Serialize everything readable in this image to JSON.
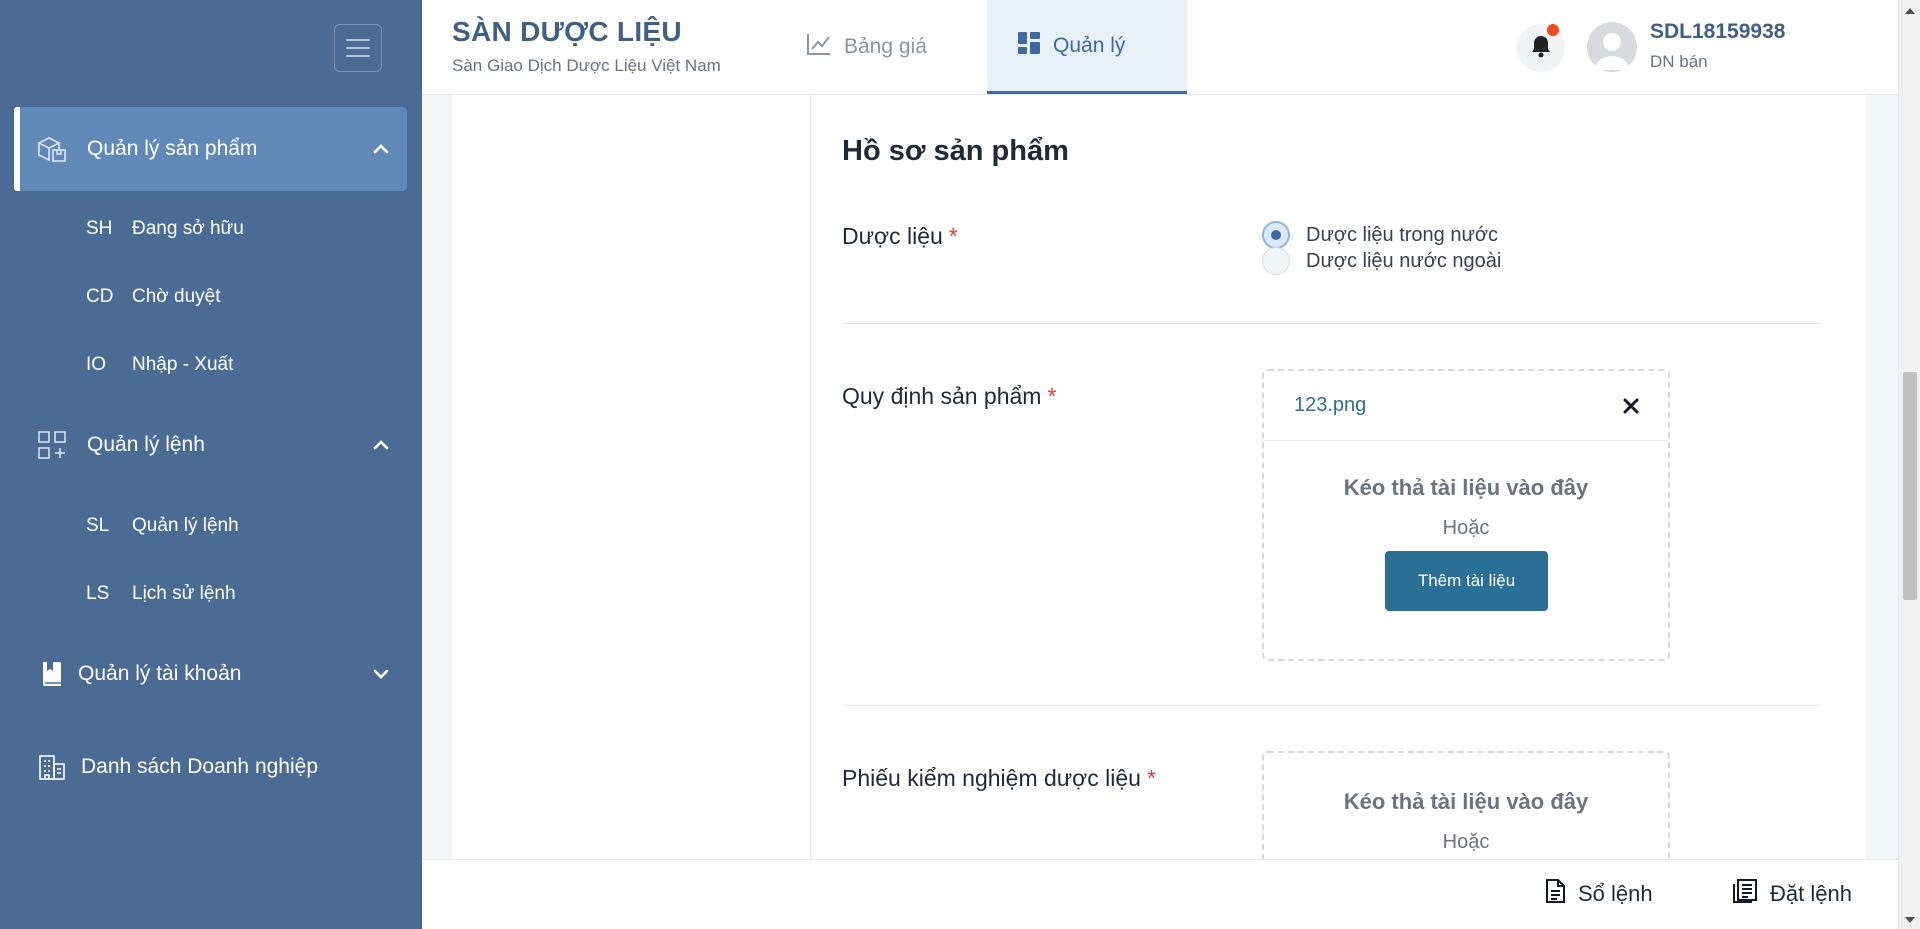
{
  "brand": {
    "title": "SÀN DƯỢC LIỆU",
    "subtitle": "Sàn Giao Dịch Dược Liệu Việt Nam"
  },
  "nav": {
    "tabs": [
      {
        "label": "Bảng giá",
        "icon": "chart-line-icon"
      },
      {
        "label": "Quản lý",
        "icon": "dashboard-icon"
      }
    ]
  },
  "user": {
    "name": "SDL18159938",
    "role": "DN bán"
  },
  "sidebar": {
    "groups": [
      {
        "label": "Quản lý sản phẩm",
        "icon": "boxes-icon",
        "chevron": "chevron-up-icon"
      },
      {
        "label": "Quản lý lệnh",
        "icon": "grid-plus-icon",
        "chevron": "chevron-up-icon"
      },
      {
        "label": "Quản lý tài khoản",
        "icon": "book-icon",
        "chevron": "chevron-down-icon"
      },
      {
        "label": "Danh sách Doanh nghiệp",
        "icon": "building-icon"
      }
    ],
    "product_items": [
      {
        "code": "SH",
        "label": "Đang sở hữu"
      },
      {
        "code": "CD",
        "label": "Chờ duyệt"
      },
      {
        "code": "IO",
        "label": "Nhập - Xuất"
      }
    ],
    "order_items": [
      {
        "code": "SL",
        "label": "Quản lý lệnh"
      },
      {
        "code": "LS",
        "label": "Lịch sử lệnh"
      }
    ]
  },
  "form": {
    "title": "Hồ sơ sản phẩm",
    "medicinal_label": "Dược liệu",
    "required_mark": "*",
    "radio_options": [
      "Dược liệu trong nước",
      "Dược liệu nước ngoài"
    ],
    "selected_option": "Dược liệu trong nước",
    "regulation_label": "Quy định sản phẩm",
    "uploaded_file": "123.png",
    "drop_text": "Kéo thả tài liệu vào đây",
    "or_text": "Hoặc",
    "add_button": "Thêm tài liệu",
    "test_label": "Phiếu kiểm nghiệm dược liệu"
  },
  "footer": {
    "order_book": "Sổ lệnh",
    "place_order": "Đặt lệnh"
  },
  "colors": {
    "sidebar": "#4a6c94",
    "sidebar_active": "#6189b8",
    "brand": "#3f5f86",
    "accent_button": "#2a6f96",
    "required": "#e23b3b",
    "notification": "#f04a23"
  }
}
